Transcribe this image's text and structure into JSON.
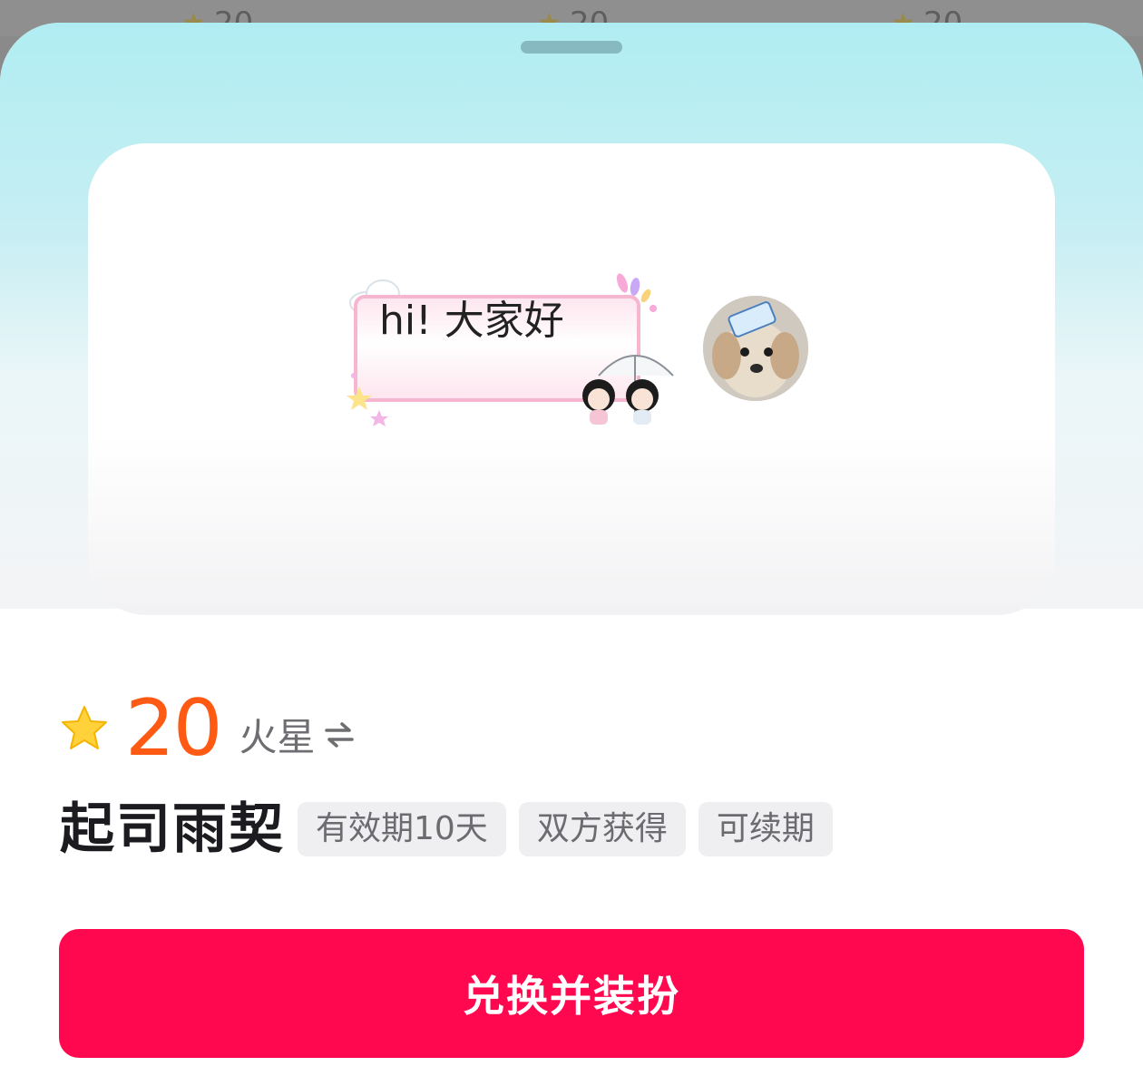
{
  "background_items": [
    {
      "price": "20"
    },
    {
      "price": "20"
    },
    {
      "price": "20"
    }
  ],
  "preview": {
    "bubble_text": "hi! 大家好",
    "avatar_label": "dog avatar"
  },
  "item": {
    "price": "20",
    "currency": "火星",
    "name": "起司雨契",
    "tags": [
      "有效期10天",
      "双方获得",
      "可续期"
    ]
  },
  "actions": {
    "redeem_label": "兑换并装扮"
  },
  "colors": {
    "accent": "#ff0850",
    "price": "#fe5a14",
    "sky": "#b0edf2"
  },
  "icons": {
    "star": "star-icon",
    "swap": "swap-arrows-icon"
  }
}
